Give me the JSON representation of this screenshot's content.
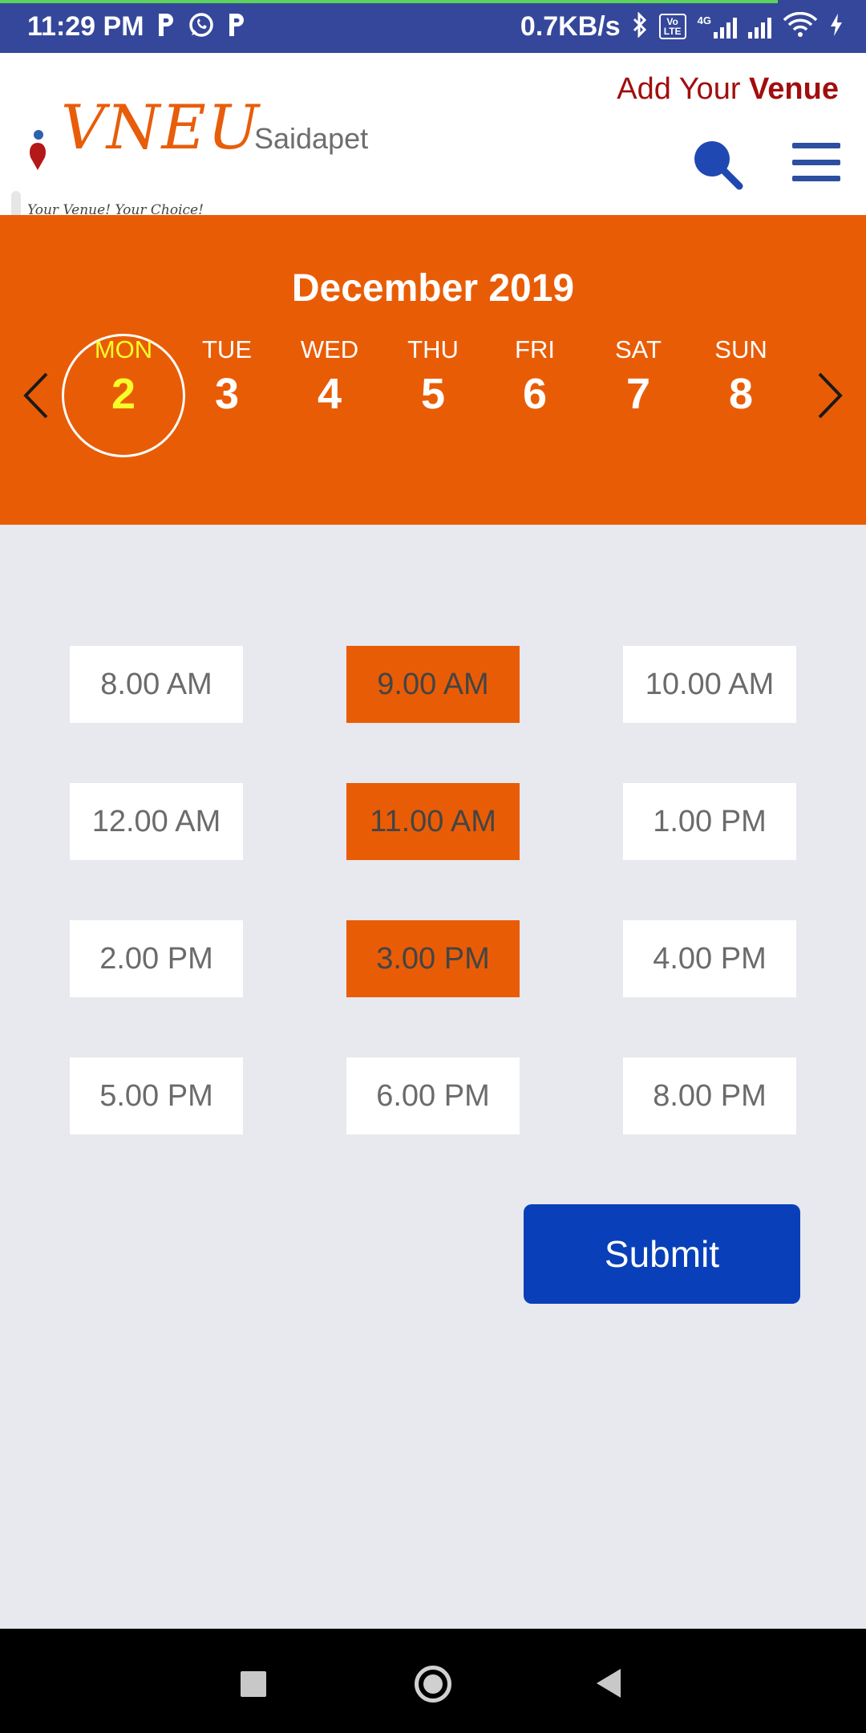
{
  "status_bar": {
    "time": "11:29 PM",
    "app_icons": [
      "parking-p-icon",
      "whatsapp-icon",
      "parking-p-icon"
    ],
    "speed": "0.7KB/s",
    "network_label": "4G",
    "volte_label": "Vo LTE"
  },
  "header": {
    "logo_text": "VNEU",
    "logo_tagline": "Your Venue! Your Choice!",
    "location": "Saidapet",
    "add_venue_prefix": "Add Your ",
    "add_venue_bold": "Venue"
  },
  "calendar": {
    "month": "December 2019",
    "days": [
      {
        "name": "MON",
        "date": "2",
        "selected": true
      },
      {
        "name": "TUE",
        "date": "3",
        "selected": false
      },
      {
        "name": "WED",
        "date": "4",
        "selected": false
      },
      {
        "name": "THU",
        "date": "5",
        "selected": false
      },
      {
        "name": "FRI",
        "date": "6",
        "selected": false
      },
      {
        "name": "SAT",
        "date": "7",
        "selected": false
      },
      {
        "name": "SUN",
        "date": "8",
        "selected": false
      }
    ]
  },
  "slots": [
    {
      "label": "8.00 AM",
      "selected": false
    },
    {
      "label": "9.00 AM",
      "selected": true
    },
    {
      "label": "10.00 AM",
      "selected": false
    },
    {
      "label": "12.00 AM",
      "selected": false
    },
    {
      "label": "11.00 AM",
      "selected": true
    },
    {
      "label": "1.00 PM",
      "selected": false
    },
    {
      "label": "2.00 PM",
      "selected": false
    },
    {
      "label": "3.00 PM",
      "selected": true
    },
    {
      "label": "4.00 PM",
      "selected": false
    },
    {
      "label": "5.00 PM",
      "selected": false
    },
    {
      "label": "6.00 PM",
      "selected": false
    },
    {
      "label": "8.00 PM",
      "selected": false
    }
  ],
  "submit_label": "Submit",
  "colors": {
    "accent_orange": "#e95c06",
    "submit_blue": "#0940b9",
    "status_bar": "#35479a",
    "add_venue_red": "#a10e0e"
  }
}
